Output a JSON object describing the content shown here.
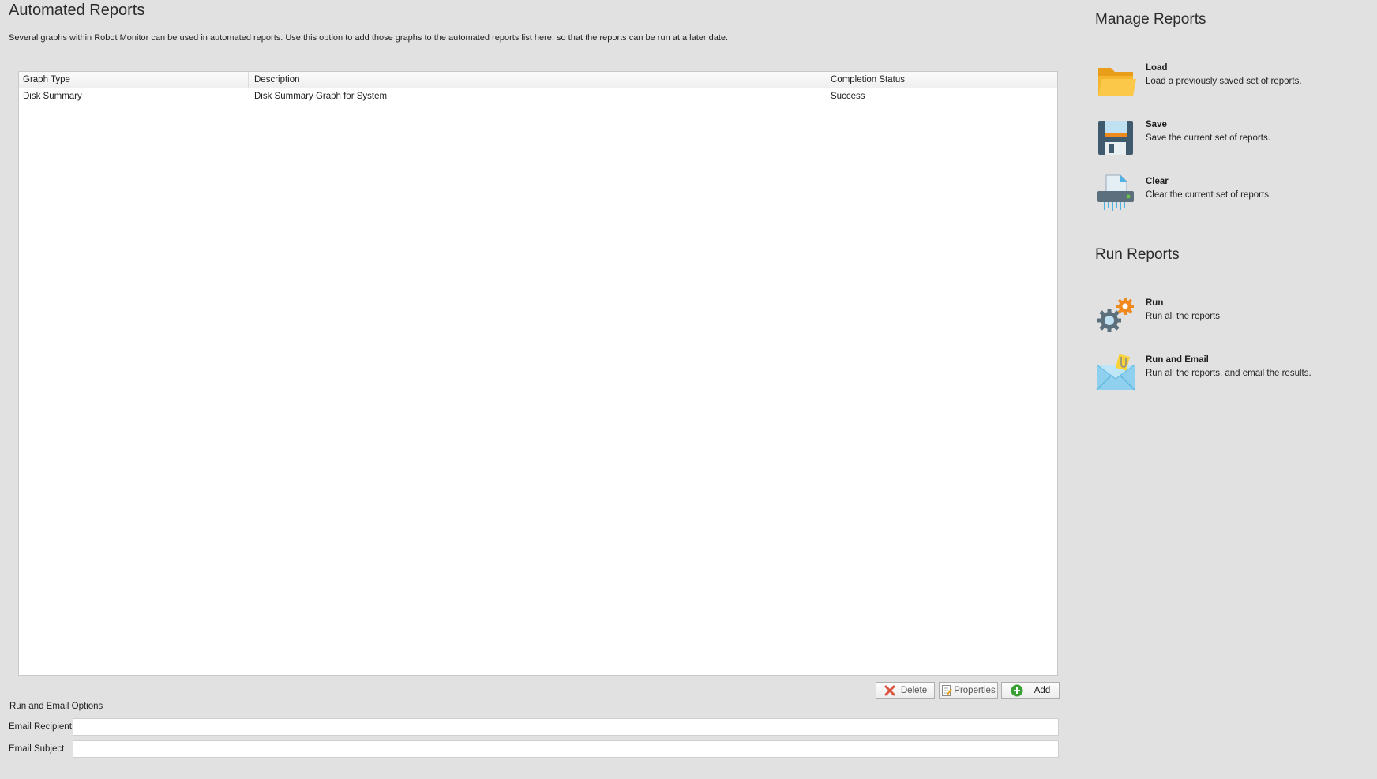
{
  "page": {
    "title": "Automated Reports",
    "description": "Several graphs within Robot Monitor can be used in automated reports.  Use this option to add those graphs to the automated reports list here, so that the reports can be run at a later date."
  },
  "grid": {
    "columns": [
      "Graph Type",
      "Description",
      "Completion Status"
    ],
    "rows": [
      [
        "Disk Summary",
        "Disk Summary Graph for System",
        "Success"
      ]
    ]
  },
  "buttons": {
    "delete": "Delete",
    "properties": "Properties",
    "add": "Add"
  },
  "options": {
    "section_label": "Run and Email Options",
    "email_recipient_label": "Email Recipient",
    "email_recipient_value": "",
    "email_subject_label": "Email Subject",
    "email_subject_value": ""
  },
  "manage": {
    "title": "Manage Reports",
    "load_title": "Load",
    "load_desc": "Load a previously saved set of reports.",
    "save_title": "Save",
    "save_desc": "Save the current set of reports.",
    "clear_title": "Clear",
    "clear_desc": "Clear the current set of reports."
  },
  "run": {
    "title": "Run Reports",
    "run_title": "Run",
    "run_desc": "Run all the reports",
    "email_title": "Run and Email",
    "email_desc": "Run all the reports, and email the results."
  },
  "colors": {
    "background": "#e1e1e1",
    "folder": "#f5b52c",
    "floppy": "#3f5a6d",
    "accent_orange": "#f08a1e",
    "add_green": "#3aa033",
    "delete_red": "#d9533f"
  },
  "icons": {
    "load": "folder-icon",
    "save": "floppy-disk-icon",
    "clear": "shredder-icon",
    "run": "gears-icon",
    "run_email": "email-envelope-icon"
  }
}
